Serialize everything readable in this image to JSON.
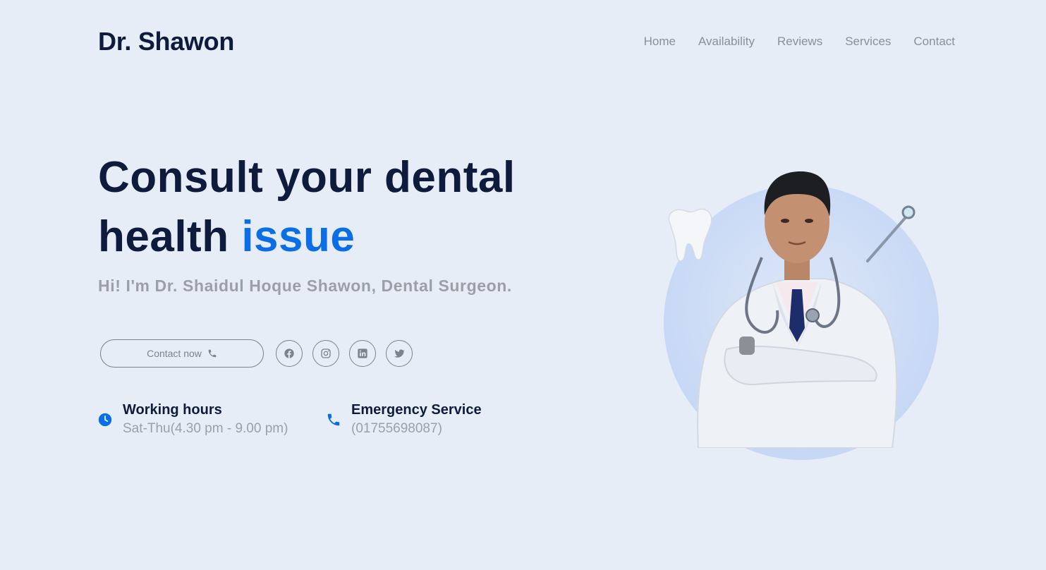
{
  "header": {
    "logo": "Dr. Shawon",
    "nav": [
      "Home",
      "Availability",
      "Reviews",
      "Services",
      "Contact"
    ]
  },
  "hero": {
    "title_line1": "Consult your dental",
    "title_line2_plain": "health ",
    "title_line2_accent": "issue",
    "subtitle": "Hi! I'm Dr. Shaidul Hoque Shawon, Dental Surgeon."
  },
  "actions": {
    "contact_label": "Contact now",
    "contact_icon": "phone-icon",
    "social": [
      "facebook-icon",
      "instagram-icon",
      "linkedin-icon",
      "twitter-icon"
    ]
  },
  "info": {
    "hours_title": "Working hours",
    "hours_value": "Sat-Thu(4.30 pm - 9.00 pm)",
    "emergency_title": "Emergency Service",
    "emergency_value": "(01755698087)"
  },
  "colors": {
    "background": "#e6edf6",
    "heading": "#0f1b3d",
    "accent": "#0a6ee6",
    "muted": "#9c9fa8"
  }
}
